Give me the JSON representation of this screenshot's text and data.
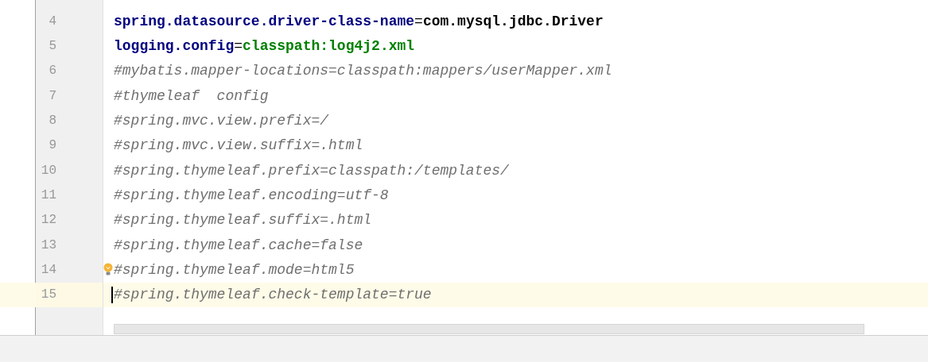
{
  "editor": {
    "lines": [
      {
        "number": "4",
        "current": false,
        "tokens": [
          {
            "kind": "key",
            "text": "spring.datasource.driver-class-name"
          },
          {
            "kind": "sep",
            "text": "="
          },
          {
            "kind": "value",
            "text": "com.mysql.jdbc.Driver"
          }
        ]
      },
      {
        "number": "5",
        "current": false,
        "tokens": [
          {
            "kind": "key",
            "text": "logging.config"
          },
          {
            "kind": "sep",
            "text": "="
          },
          {
            "kind": "string",
            "text": "classpath:log4j2.xml"
          }
        ]
      },
      {
        "number": "6",
        "current": false,
        "tokens": [
          {
            "kind": "comment",
            "text": "#mybatis.mapper-locations=classpath:mappers/userMapper.xml"
          }
        ]
      },
      {
        "number": "7",
        "current": false,
        "tokens": [
          {
            "kind": "comment",
            "text": "#thymeleaf  config"
          }
        ]
      },
      {
        "number": "8",
        "current": false,
        "tokens": [
          {
            "kind": "comment",
            "text": "#spring.mvc.view.prefix=/"
          }
        ]
      },
      {
        "number": "9",
        "current": false,
        "tokens": [
          {
            "kind": "comment",
            "text": "#spring.mvc.view.suffix=.html"
          }
        ]
      },
      {
        "number": "10",
        "current": false,
        "tokens": [
          {
            "kind": "comment",
            "text": "#spring.thymeleaf.prefix=classpath:/templates/"
          }
        ]
      },
      {
        "number": "11",
        "current": false,
        "tokens": [
          {
            "kind": "comment",
            "text": "#spring.thymeleaf.encoding=utf-8"
          }
        ]
      },
      {
        "number": "12",
        "current": false,
        "tokens": [
          {
            "kind": "comment",
            "text": "#spring.thymeleaf.suffix=.html"
          }
        ]
      },
      {
        "number": "13",
        "current": false,
        "tokens": [
          {
            "kind": "comment",
            "text": "#spring.thymeleaf.cache=false"
          }
        ]
      },
      {
        "number": "14",
        "current": false,
        "intention_bulb": true,
        "tokens": [
          {
            "kind": "comment",
            "text": "#spring.thymeleaf.mode=html5"
          }
        ]
      },
      {
        "number": "15",
        "current": true,
        "tokens": [
          {
            "kind": "comment",
            "text": "#spring.thymeleaf.check-template=true"
          }
        ]
      }
    ]
  }
}
